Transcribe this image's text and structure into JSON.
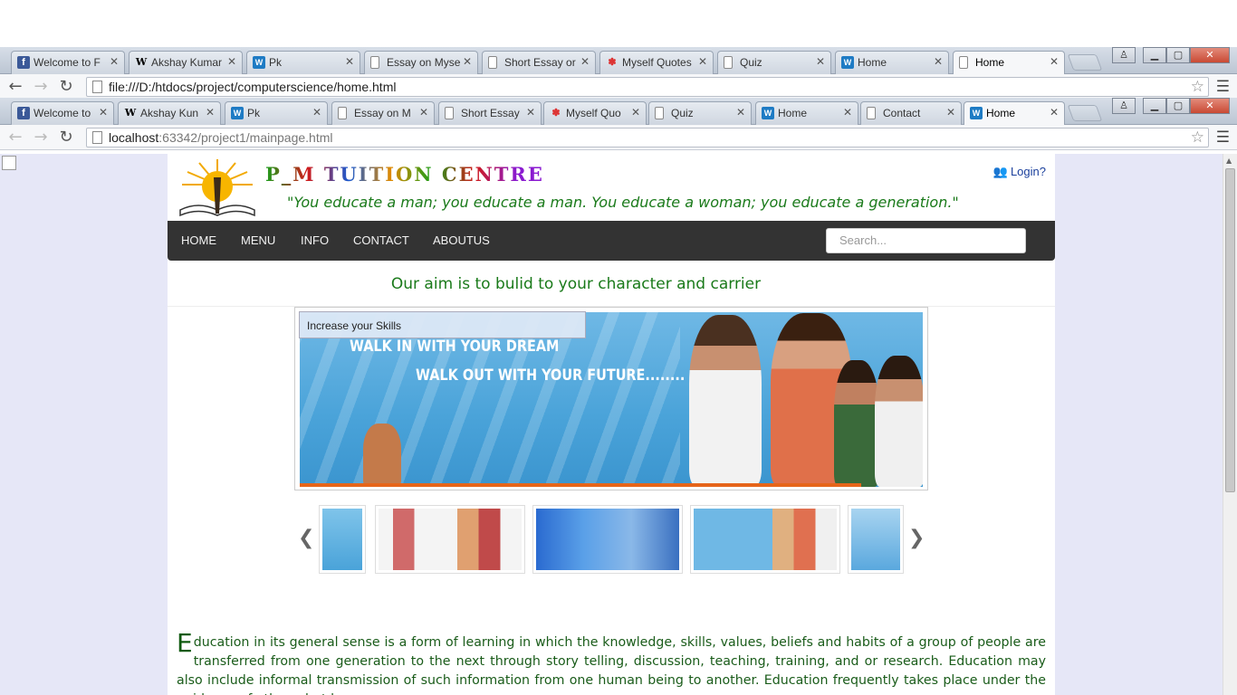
{
  "browser_back": {
    "tabs": [
      {
        "label": "Welcome to F",
        "favicon": "f"
      },
      {
        "label": "Akshay Kumar",
        "favicon": "W"
      },
      {
        "label": "Pk",
        "favicon": "W"
      },
      {
        "label": "Essay on Myse",
        "favicon": "doc"
      },
      {
        "label": "Short Essay or",
        "favicon": "doc"
      },
      {
        "label": "Myself Quotes",
        "favicon": "pin"
      },
      {
        "label": "Quiz",
        "favicon": "doc"
      },
      {
        "label": "Home",
        "favicon": "W"
      },
      {
        "label": "Home",
        "favicon": "doc"
      }
    ],
    "url": "file:///D:/htdocs/project/computerscience/home.html"
  },
  "browser_front": {
    "tabs": [
      {
        "label": "Welcome to",
        "favicon": "f"
      },
      {
        "label": "Akshay Kun",
        "favicon": "W"
      },
      {
        "label": "Pk",
        "favicon": "W"
      },
      {
        "label": "Essay on M",
        "favicon": "doc"
      },
      {
        "label": "Short Essay",
        "favicon": "doc"
      },
      {
        "label": "Myself Quo",
        "favicon": "pin"
      },
      {
        "label": "Quiz",
        "favicon": "doc"
      },
      {
        "label": "Home",
        "favicon": "W"
      },
      {
        "label": "Contact",
        "favicon": "doc"
      },
      {
        "label": "Home",
        "favicon": "W"
      }
    ],
    "url_host": "localhost",
    "url_path": ":63342/project1/mainpage.html"
  },
  "site": {
    "name": "P_M TUITION CENTRE",
    "tagline": "\"You educate a man; you educate a man. You educate a woman; you educate a generation.\"",
    "login": "Login?"
  },
  "nav": {
    "items": [
      "HOME",
      "MENU",
      "INFO",
      "CONTACT",
      "ABOUTUS"
    ],
    "search_placeholder": "Search..."
  },
  "aim": "Our aim is to bulid to your character and carrier",
  "slider": {
    "caption": "Increase your Skills",
    "line1": "WALK IN WITH YOUR DREAM",
    "line2": "WALK OUT WITH YOUR FUTURE........"
  },
  "body_text": {
    "dropcap": "E",
    "text": "ducation in its general sense is a form of learning in which the knowledge, skills, values, beliefs and habits of a group of people are transferred from one generation to the next through story telling, discussion, teaching, training, and or research. Education may also include informal transmission of such information from one human being to another. Education frequently takes place under the guidance of others, but learners"
  },
  "colors": {
    "accent_green": "#1a7a1a",
    "navbar": "#333333",
    "page_bg": "#e6e7f7"
  }
}
